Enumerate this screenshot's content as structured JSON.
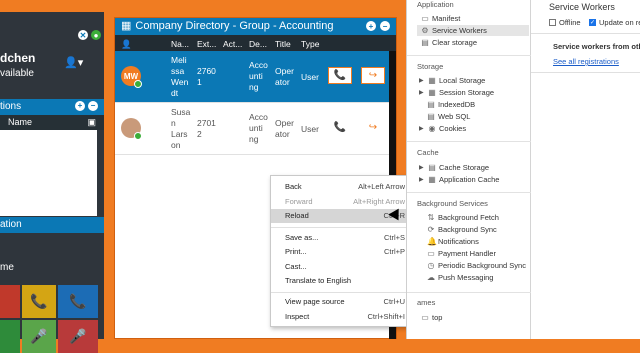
{
  "left": {
    "name": "dchen",
    "status": "vailable",
    "section1": "tions",
    "col_name": "Name",
    "section2": "ation",
    "me_label": "me"
  },
  "directory": {
    "title": "Company Directory - Group - Accounting",
    "columns": [
      "Na...",
      "Ext...",
      "Act...",
      "De...",
      "Title",
      "Type"
    ],
    "rows": [
      {
        "initials": "MW",
        "name": "Meli\nssa\nWen\ndt",
        "ext": "2760\n1",
        "dept": "Acco\nunti\nng",
        "title": "Oper\nator",
        "type": "User",
        "selected": true
      },
      {
        "initials": "",
        "name": "Susa\nn\nLars\non",
        "ext": "2701\n2",
        "dept": "Acco\nunti\nng",
        "title": "Oper\nator",
        "type": "User",
        "selected": false
      }
    ]
  },
  "context_menu": {
    "items": [
      {
        "label": "Back",
        "key": "Alt+Left Arrow",
        "disabled": false
      },
      {
        "label": "Forward",
        "key": "Alt+Right Arrow",
        "disabled": true
      },
      {
        "label": "Reload",
        "key": "Ctrl+R",
        "disabled": false,
        "hover": true
      },
      {
        "label": "Save as...",
        "key": "Ctrl+S",
        "disabled": false
      },
      {
        "label": "Print...",
        "key": "Ctrl+P",
        "disabled": false
      },
      {
        "label": "Cast...",
        "key": "",
        "disabled": false
      },
      {
        "label": "Translate to English",
        "key": "",
        "disabled": false
      },
      {
        "label": "View page source",
        "key": "Ctrl+U",
        "disabled": false
      },
      {
        "label": "Inspect",
        "key": "Ctrl+Shift+I",
        "disabled": false
      }
    ]
  },
  "devtools": {
    "application_label": "Application",
    "manifest": "Manifest",
    "service_workers": "Service Workers",
    "clear_storage": "Clear storage",
    "storage_label": "Storage",
    "local_storage": "Local Storage",
    "session_storage": "Session Storage",
    "indexeddb": "IndexedDB",
    "websql": "Web SQL",
    "cookies": "Cookies",
    "cache_label": "Cache",
    "cache_storage": "Cache Storage",
    "application_cache": "Application Cache",
    "bg_label": "Background Services",
    "bg_fetch": "Background Fetch",
    "bg_sync": "Background Sync",
    "notifications": "Notifications",
    "payment": "Payment Handler",
    "periodic_sync": "Periodic Background Sync",
    "push": "Push Messaging",
    "frames_label": "ames",
    "top": "top",
    "sw_title": "Service Workers",
    "offline": "Offline",
    "update_on_reload": "Update on rel",
    "others": "Service workers from oth",
    "see_all": "See all registrations"
  }
}
